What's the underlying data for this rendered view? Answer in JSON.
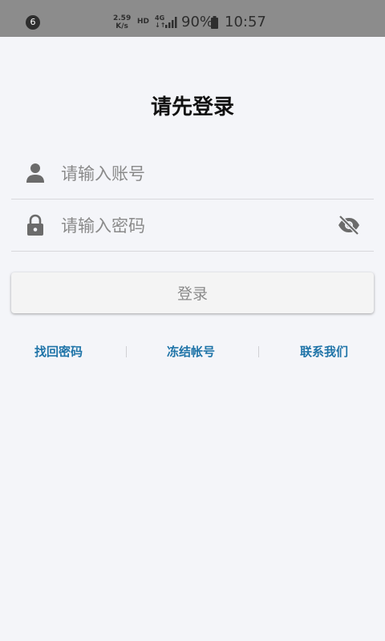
{
  "status_bar": {
    "notification_count": "6",
    "net_speed_value": "2.59",
    "net_speed_unit": "K/s",
    "hd_label": "HD",
    "network_type": "4G",
    "network_arrows": "↓↑",
    "battery_percent": "90%",
    "time": "10:57"
  },
  "login": {
    "title": "请先登录",
    "account_placeholder": "请输入账号",
    "account_value": "",
    "password_placeholder": "请输入密码",
    "password_value": "",
    "login_button_label": "登录"
  },
  "links": {
    "forgot_password": "找回密码",
    "freeze_account": "冻结帐号",
    "contact_us": "联系我们"
  },
  "icons": {
    "account": "person-icon",
    "password": "lock-icon",
    "toggle_visibility": "eye-off-icon"
  },
  "colors": {
    "status_bar": "#8c8c8c",
    "background": "#f4f5f9",
    "link": "#1f74a8",
    "placeholder": "#8a8a8a",
    "icon": "#6b6b6b"
  }
}
